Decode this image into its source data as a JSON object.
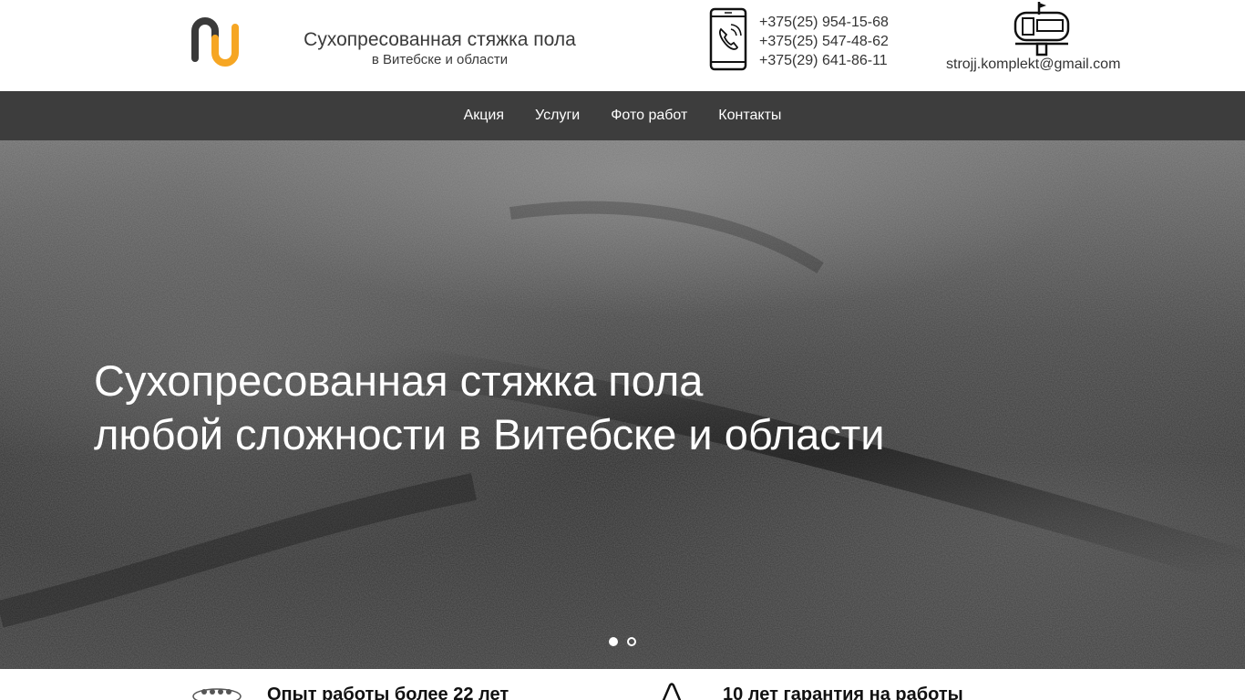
{
  "header": {
    "logo_icon": "paperclip-n-logo",
    "title": "Сухопресованная стяжка пола",
    "subtitle": "в Витебске и области",
    "phone_icon": "smartphone-call-icon",
    "phones": [
      "+375(25) 954-15-68",
      "+375(25) 547-48-62",
      "+375(29) 641-86-11"
    ],
    "mail_icon": "mailbox-icon",
    "email": "strojj.komplekt@gmail.com"
  },
  "nav": {
    "items": [
      {
        "label": "Акция"
      },
      {
        "label": "Услуги"
      },
      {
        "label": "Фото работ"
      },
      {
        "label": "Контакты"
      }
    ]
  },
  "hero": {
    "title_line1": "Сухопресованная стяжка пола",
    "title_line2": "любой сложности в Витебске и области",
    "slides": 2,
    "active_slide": 1
  },
  "features": [
    {
      "icon": "team-icon",
      "text": "Опыт работы более 22 лет"
    },
    {
      "icon": "shield-icon",
      "text": "10 лет гарантия на работы"
    }
  ],
  "colors": {
    "logo_dark": "#3a3a3a",
    "logo_orange": "#f6a623",
    "nav_bg": "#3d3d3d",
    "text_white": "#ffffff"
  }
}
